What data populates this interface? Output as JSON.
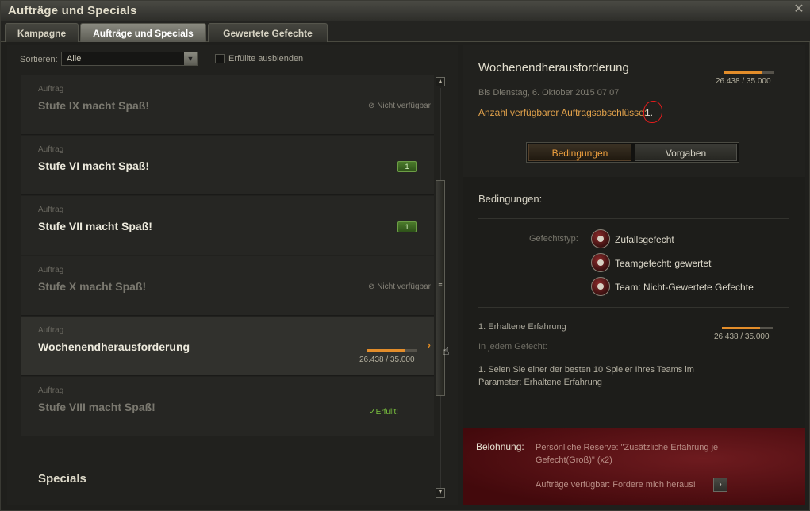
{
  "window": {
    "title": "Aufträge und Specials",
    "close_icon": "close-icon"
  },
  "tabs": [
    {
      "label": "Kampagne",
      "active": false
    },
    {
      "label": "Aufträge und Specials",
      "active": true
    },
    {
      "label": "Gewertete Gefechte",
      "active": false
    }
  ],
  "filter": {
    "sort_label": "Sortieren:",
    "sort_value": "Alle",
    "hide_completed_label": "Erfüllte ausblenden",
    "hide_completed_checked": false
  },
  "missions": [
    {
      "kind": "Auftrag",
      "title": "Stufe IX macht Spaß!",
      "status": "Nicht verfügbar",
      "state": "unavailable"
    },
    {
      "kind": "Auftrag",
      "title": "Stufe VI macht Spaß!",
      "badge": "1",
      "state": "available"
    },
    {
      "kind": "Auftrag",
      "title": "Stufe VII macht Spaß!",
      "badge": "1",
      "state": "available"
    },
    {
      "kind": "Auftrag",
      "title": "Stufe X macht Spaß!",
      "status": "Nicht verfügbar",
      "state": "unavailable"
    },
    {
      "kind": "Auftrag",
      "title": "Wochenendherausforderung",
      "progress_text": "26.438 / 35.000",
      "progress_fraction": 0.755,
      "state": "selected"
    },
    {
      "kind": "Auftrag",
      "title": "Stufe VIII macht Spaß!",
      "status": "Erfüllt!",
      "state": "completed"
    }
  ],
  "specials_heading": "Specials",
  "detail": {
    "title": "Wochenendherausforderung",
    "progress_text": "26.438 / 35.000",
    "progress_fraction": 0.755,
    "until": "Bis Dienstag, 6. Oktober 2015 07:07",
    "count_label": "Anzahl verfügbarer Auftragsabschlüsse:",
    "count_value": "1.",
    "toggle_on": "Bedingungen",
    "toggle_off": "Vorgaben",
    "conditions_heading": "Bedingungen:",
    "battle_type_label": "Gefechtstyp:",
    "battle_types": [
      "Zufallsgefecht",
      "Teamgefecht: gewertet",
      "Team: Nicht-Gewertete Gefechte"
    ],
    "cond_title": "1. Erhaltene Erfahrung",
    "cond_progress_text": "26.438 / 35.000",
    "cond_progress_fraction": 0.755,
    "cond_scope": "In jedem Gefecht:",
    "cond_desc": "1. Seien Sie einer der besten 10 Spieler Ihres Teams im Parameter: Erhaltene Erfahrung",
    "reward_label": "Belohnung:",
    "reward_text": "Persönliche Reserve: \"Zusätzliche Erfahrung je Gefecht(Groß)\" (x2)",
    "reward_link": "Aufträge verfügbar: Fordere mich heraus!"
  },
  "colors": {
    "accent_orange": "#e38d2a",
    "available_green": "#4b7a2b",
    "completed_green": "#7bc43f",
    "reward_red": "#6e1b1f"
  }
}
